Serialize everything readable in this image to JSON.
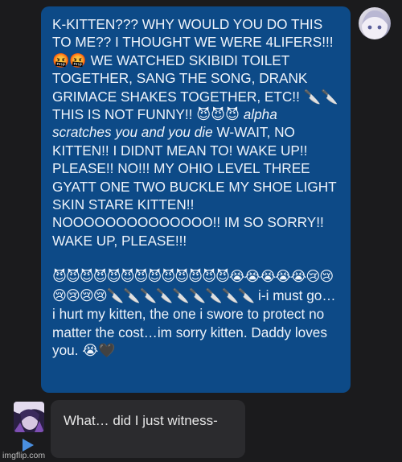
{
  "outgoing_message": {
    "paragraph1": "K-KITTEN??? WHY WOULD YOU DO THIS TO ME?? I THOUGHT WE WERE 4LIFERS!!! 🤬🤬 WE WATCHED SKIBIDI TOILET TOGETHER, SANG THE SONG, DRANK GRIMACE SHAKES TOGETHER, ETC!! 🔪🔪THIS IS NOT FUNNY!! 😈😈😈",
    "italic_action": " alpha scratches you and you die",
    "paragraph1_end": "W-WAIT, NO KITTEN!! I DIDNT MEAN TO! WAKE UP!! PLEASE!! NO!!! MY OHIO LEVEL THREE GYATT ONE TWO BUCKLE MY SHOE LIGHT SKIN STARE KITTEN!! NOOOOOOOOOOOOOO!! IM SO SORRY!! WAKE UP, PLEASE!!!",
    "emoji_line": "😈😈😈😈😈😈😈😈😈😈😈😈😈😭😭😭😭😭😢😢😢😢😢😢🔪🔪🔪🔪🔪🔪🔪🔪🔪",
    "paragraph2": " i-i must go… i hurt my kitten, the one i swore to protect no matter the cost…im sorry kitten. Daddy loves you. 😭🖤"
  },
  "incoming_message": {
    "text": "What… did I just witness-"
  },
  "watermark": "imgflip.com",
  "colors": {
    "background": "#1b1b1d",
    "outgoing_bubble": "#0d4a87",
    "incoming_bubble": "#2b2b2e",
    "play_icon": "#4a8fe0"
  },
  "icons": {
    "left_avatar": "anime-avatar-icon",
    "right_avatar": "anime-avatar-icon",
    "play": "play-icon"
  }
}
